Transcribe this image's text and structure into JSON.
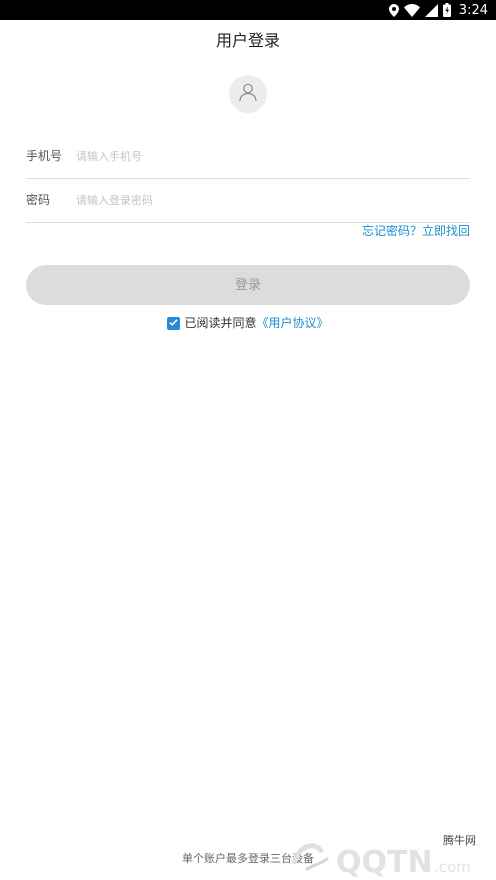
{
  "status_bar": {
    "time": "3:24"
  },
  "header": {
    "title": "用户登录"
  },
  "avatar": {
    "icon": "user-icon"
  },
  "form": {
    "phone": {
      "label": "手机号",
      "placeholder": "请输入手机号",
      "value": ""
    },
    "password": {
      "label": "密码",
      "placeholder": "请输入登录密码",
      "value": ""
    },
    "forgot_link": "忘记密码？立即找回"
  },
  "login_button": {
    "label": "登录"
  },
  "agreement": {
    "checked": true,
    "text": "已阅读并同意",
    "link": "《用户协议》"
  },
  "footer": {
    "note": "单个账户最多登录三台设备"
  },
  "watermark": {
    "site_name": "腾牛网"
  },
  "colors": {
    "accent": "#1a8fd0",
    "button_disabled_bg": "#dcdcdc",
    "checkbox": "#2a8ad8"
  }
}
